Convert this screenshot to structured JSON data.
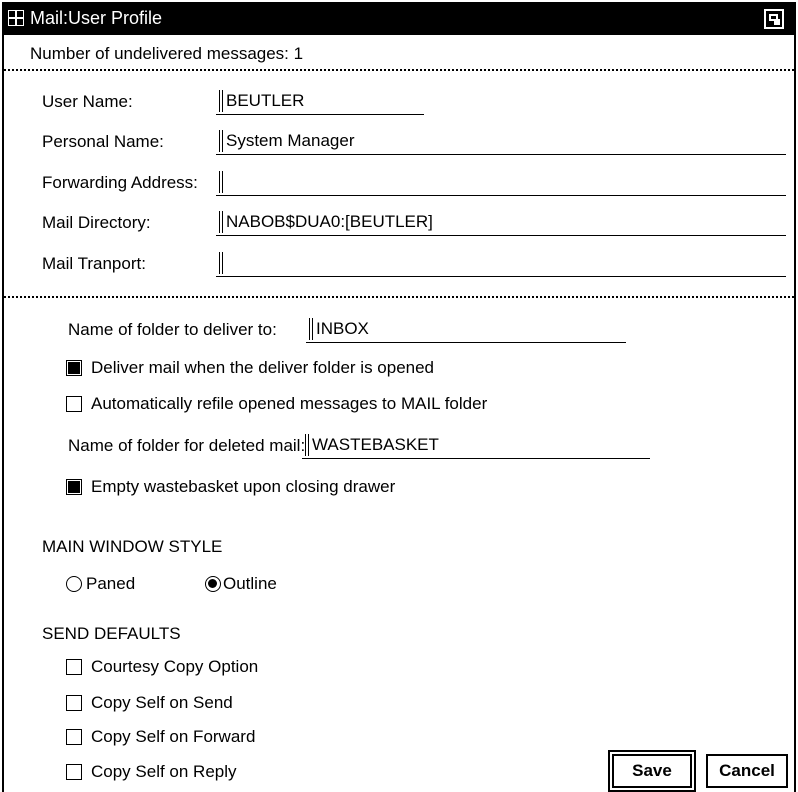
{
  "window": {
    "title": "Mail:User Profile"
  },
  "status": {
    "undelivered": "Number of undelivered messages: 1"
  },
  "profile": {
    "user_name_label": "User Name:",
    "user_name_value": "BEUTLER",
    "personal_name_label": "Personal Name:",
    "personal_name_value": "System Manager",
    "forwarding_label": "Forwarding Address:",
    "forwarding_value": "",
    "mail_dir_label": "Mail Directory:",
    "mail_dir_value": "NABOB$DUA0:[BEUTLER]",
    "transport_label": "Mail Tranport:",
    "transport_value": ""
  },
  "folders": {
    "deliver_label": "Name of folder to deliver to:",
    "deliver_value": "INBOX",
    "deliver_on_open_label": "Deliver mail when the deliver folder is opened",
    "deliver_on_open_checked": true,
    "refile_label": "Automatically refile opened messages to MAIL folder",
    "refile_checked": false,
    "deleted_label": "Name of folder for deleted mail:",
    "deleted_value": "WASTEBASKET",
    "empty_label": "Empty wastebasket upon closing drawer",
    "empty_checked": true
  },
  "window_style": {
    "heading": "MAIN WINDOW STYLE",
    "paned_label": "Paned",
    "outline_label": "Outline",
    "selected": "Outline"
  },
  "send_defaults": {
    "heading": "SEND DEFAULTS",
    "options": [
      {
        "label": "Courtesy Copy Option",
        "checked": false
      },
      {
        "label": "Copy Self on Send",
        "checked": false
      },
      {
        "label": "Copy Self on Forward",
        "checked": false
      },
      {
        "label": "Copy Self on Reply",
        "checked": false
      }
    ]
  },
  "buttons": {
    "save": "Save",
    "cancel": "Cancel"
  }
}
